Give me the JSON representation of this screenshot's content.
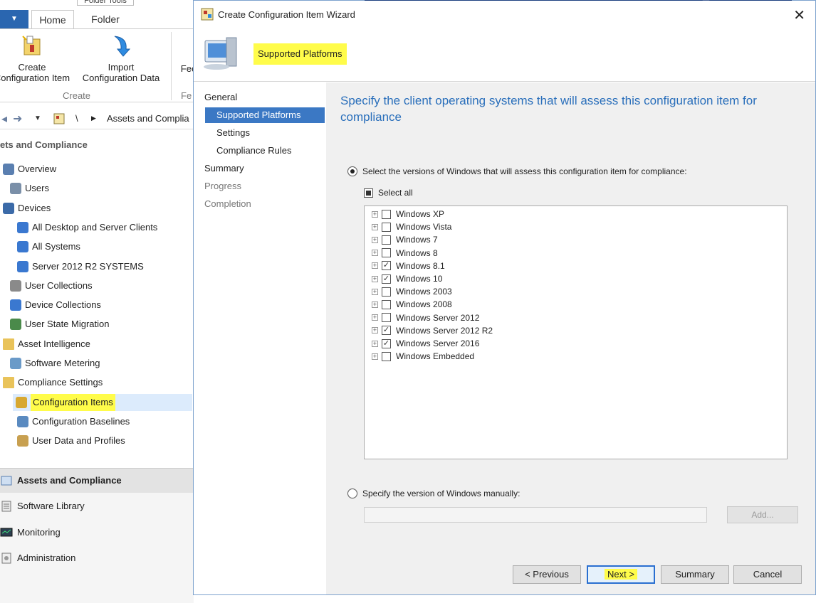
{
  "console": {
    "ribbon": {
      "folder_tools": "Folder Tools",
      "tabs": [
        "Home",
        "Folder"
      ],
      "create_ci_label": "Create\nConfiguration Item",
      "import_label": "Import\nConfiguration Data",
      "fee_label": "Fee",
      "group_create": "Create",
      "group_fe": "Fe"
    },
    "breadcrumb": "Assets and Complia",
    "breadcrumb_sep": "\\",
    "nav_header": "ets and Compliance",
    "tree": [
      {
        "label": "Overview",
        "icon": "overview-icon"
      },
      {
        "label": "Users",
        "icon": "user-icon"
      },
      {
        "label": "Devices",
        "icon": "devices-icon"
      },
      {
        "label": "All Desktop and Server Clients",
        "icon": "collection-icon"
      },
      {
        "label": "All Systems",
        "icon": "collection-icon"
      },
      {
        "label": "Server 2012  R2 SYSTEMS",
        "icon": "collection-icon"
      },
      {
        "label": "User Collections",
        "icon": "user-collections-icon"
      },
      {
        "label": "Device Collections",
        "icon": "device-collections-icon"
      },
      {
        "label": "User State Migration",
        "icon": "migration-icon"
      },
      {
        "label": "Asset Intelligence",
        "icon": "folder-icon"
      },
      {
        "label": "Software Metering",
        "icon": "metering-icon"
      },
      {
        "label": "Compliance Settings",
        "icon": "folder-icon"
      },
      {
        "label": "Configuration Items",
        "icon": "config-item-icon"
      },
      {
        "label": "Configuration Baselines",
        "icon": "baseline-icon"
      },
      {
        "label": "User Data and Profiles",
        "icon": "profile-icon"
      }
    ],
    "workspaces": [
      "Assets and Compliance",
      "Software Library",
      "Monitoring",
      "Administration"
    ]
  },
  "wizard": {
    "window_title": "Create Configuration Item Wizard",
    "page_title": "Supported Platforms",
    "steps": [
      {
        "label": "General",
        "state": "done"
      },
      {
        "label": "Supported Platforms",
        "state": "active"
      },
      {
        "label": "Settings",
        "state": "pending"
      },
      {
        "label": "Compliance Rules",
        "state": "pending"
      },
      {
        "label": "Summary",
        "state": "pending"
      },
      {
        "label": "Progress",
        "state": "muted"
      },
      {
        "label": "Completion",
        "state": "muted"
      }
    ],
    "heading": "Specify the client operating systems that will assess this configuration item for compliance",
    "radio_versions": "Select the versions of Windows that will assess this configuration item for compliance:",
    "select_all": "Select all",
    "os_list": [
      {
        "label": "Windows XP",
        "checked": false
      },
      {
        "label": "Windows Vista",
        "checked": false
      },
      {
        "label": "Windows 7",
        "checked": false
      },
      {
        "label": "Windows 8",
        "checked": false
      },
      {
        "label": "Windows 8.1",
        "checked": true
      },
      {
        "label": "Windows 10",
        "checked": true
      },
      {
        "label": "Windows 2003",
        "checked": false
      },
      {
        "label": "Windows 2008",
        "checked": false
      },
      {
        "label": "Windows Server 2012",
        "checked": false
      },
      {
        "label": "Windows Server 2012 R2",
        "checked": true
      },
      {
        "label": "Windows Server 2016",
        "checked": true
      },
      {
        "label": "Windows Embedded",
        "checked": false
      }
    ],
    "radio_manual": "Specify the version of Windows manually:",
    "manual_value": "",
    "add_label": "Add...",
    "buttons": {
      "previous": "< Previous",
      "next": "Next >",
      "summary": "Summary",
      "cancel": "Cancel"
    }
  },
  "colors": {
    "accent": "#3b78c4",
    "heading": "#2a6fbb",
    "highlight": "#fffc4a"
  }
}
